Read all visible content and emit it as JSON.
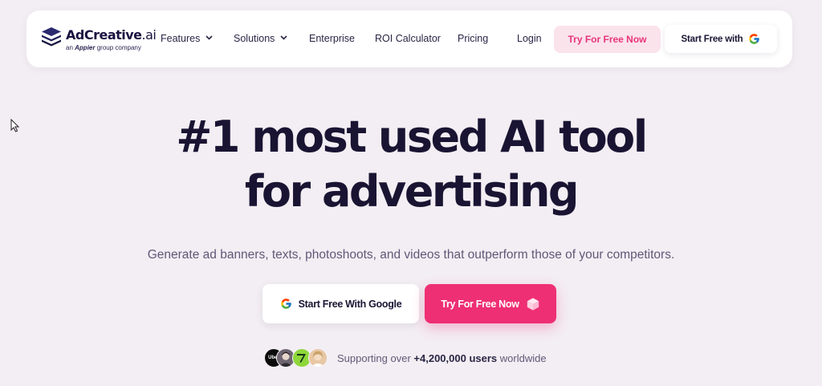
{
  "navbar": {
    "logo": {
      "name_main": "AdCreative",
      "name_tld": ".ai",
      "sub_prefix": "an",
      "sub_brand": "Appier",
      "sub_suffix": "group company"
    },
    "links": {
      "features": "Features",
      "solutions": "Solutions",
      "enterprise": "Enterprise",
      "roi": "ROI Calculator",
      "pricing": "Pricing",
      "login": "Login"
    },
    "try_button": "Try For Free Now",
    "google_button": "Start Free with"
  },
  "hero": {
    "title_line1": "#1 most used AI tool",
    "title_line2": "for advertising",
    "subtitle": "Generate ad banners, texts, photoshoots, and videos that outperform those of your competitors.",
    "google_button": "Start Free With Google",
    "try_button": "Try For Free Now",
    "avatar_label": "Uber",
    "support_prefix": "Supporting over",
    "support_count": "+4,200,000 users",
    "support_suffix": "worldwide"
  },
  "colors": {
    "background": "#f3eef3",
    "accent": "#ee2f73",
    "accent_light": "#fbe3ec",
    "text_dark": "#1a1433"
  },
  "icons": [
    "cursor-icon",
    "logo-stack-icon",
    "chevron-down-icon",
    "google-icon",
    "cube-icon"
  ]
}
